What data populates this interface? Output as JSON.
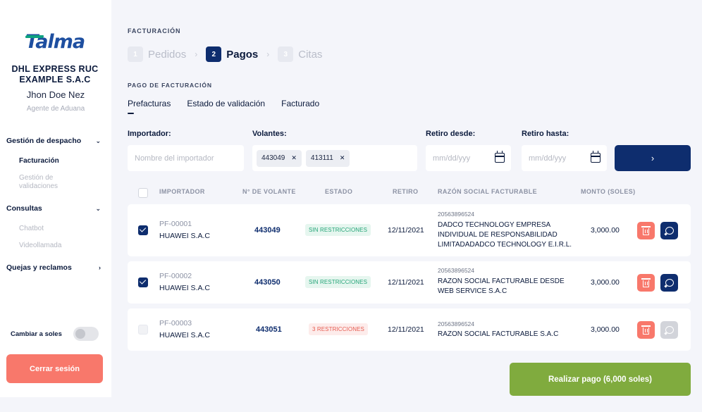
{
  "sidebar": {
    "logo_text": "Talma",
    "company": "DHL EXPRESS RUC EXAMPLE S.A.C",
    "user_name": "Jhon Doe Nez",
    "role": "Agente de Aduana",
    "sections": [
      {
        "label": "Gestión de despacho",
        "items": [
          "Facturación",
          "Gestión de validaciones"
        ]
      },
      {
        "label": "Consultas",
        "items": [
          "Chatbot",
          "Videollamada"
        ]
      },
      {
        "label": "Quejas y reclamos",
        "items": []
      }
    ],
    "toggle_label": "Cambiar a soles",
    "logout_label": "Cerrar sesión"
  },
  "main": {
    "eyebrow": "FACTURACIÓN",
    "steps": [
      {
        "num": "1",
        "label": "Pedidos"
      },
      {
        "num": "2",
        "label": "Pagos"
      },
      {
        "num": "3",
        "label": "Citas"
      }
    ],
    "section_title": "PAGO DE FACTURACIÓN",
    "tabs": [
      "Prefacturas",
      "Estado de validación",
      "Facturado"
    ],
    "filters": {
      "importador_label": "Importador:",
      "importador_placeholder": "Nombre del importador",
      "volantes_label": "Volantes:",
      "volantes_chips": [
        "443049",
        "413111"
      ],
      "desde_label": "Retiro desde:",
      "hasta_label": "Retiro hasta:",
      "date_placeholder": "mm/dd/yyy",
      "search_arrow": "›"
    },
    "table": {
      "headers": [
        "IMPORTADOR",
        "N° DE VOLANTE",
        "ESTADO",
        "RETIRO",
        "RAZÓN SOCIAL FACTURABLE",
        "MONTO (SOLES)"
      ],
      "rows": [
        {
          "code": "PF-00001",
          "importer": "HUAWEI S.A.C",
          "volante": "443049",
          "estado": "SIN RESTRICCIONES",
          "retiro": "12/11/2021",
          "ruc": "20563896524",
          "razon": [
            "DADCO TECHNOLOGY EMPRESA",
            "INDIVIDUAL DE RESPONSABILIDAD",
            "LIMITADADADCO TECHNOLOGY E.I.R.L."
          ],
          "monto": "3,000.00"
        },
        {
          "code": "PF-00002",
          "importer": "HUAWEI S.A.C",
          "volante": "443050",
          "estado": "SIN RESTRICCIONES",
          "retiro": "12/11/2021",
          "ruc": "20563896524",
          "razon": [
            "RAZON SOCIAL FACTURABLE DESDE",
            "WEB SERVICE S.A.C"
          ],
          "monto": "3,000.00"
        },
        {
          "code": "PF-00003",
          "importer": "HUAWEI S.A.C",
          "volante": "443051",
          "estado": "3 RESTRICCIONES",
          "retiro": "12/11/2021",
          "ruc": "20563896524",
          "razon": [
            "RAZON SOCIAL FACTURABLE S.A.C"
          ],
          "monto": "3,000.00"
        }
      ]
    },
    "pay_button": "Realizar pago (6,000 soles)"
  },
  "colors": {
    "primary": "#0e2d6e",
    "danger": "#f8786b",
    "success_btn": "#80ab3e",
    "badge_ok": "#23a477",
    "badge_bad": "#e65b4f"
  }
}
